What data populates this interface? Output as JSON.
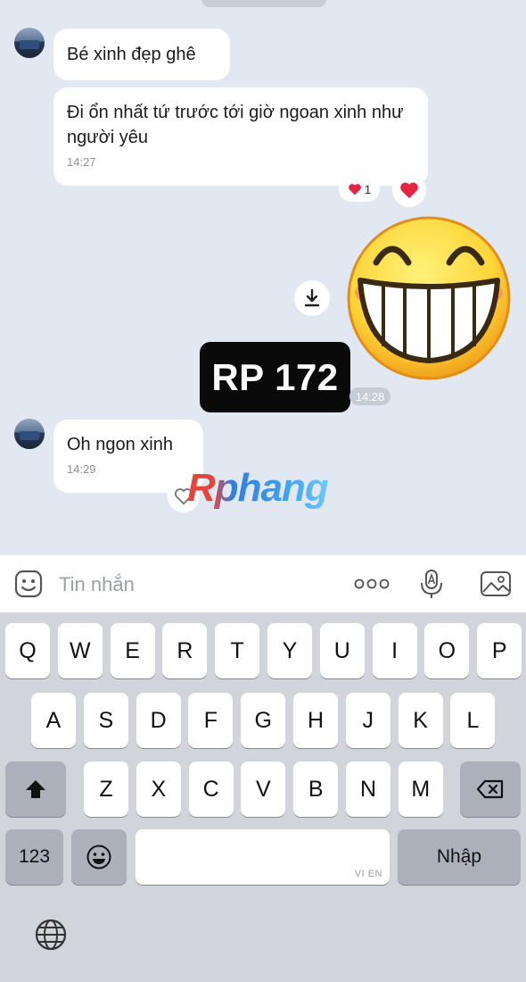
{
  "messages": [
    {
      "text": "Bé xinh đẹp ghê"
    },
    {
      "text": "Đi ổn nhất tứ trước tới giờ ngoan xinh như người yêu",
      "time": "14:27"
    },
    {
      "text": "Oh ngon xinh",
      "time": "14:29"
    }
  ],
  "reactions": {
    "heart_count": "1"
  },
  "sticker": {
    "label": "RP 172",
    "time": "14:28"
  },
  "watermark": "Rphang",
  "input": {
    "placeholder": "Tin nhắn"
  },
  "keyboard": {
    "row1": [
      "Q",
      "W",
      "E",
      "R",
      "T",
      "Y",
      "U",
      "I",
      "O",
      "P"
    ],
    "row2": [
      "A",
      "S",
      "D",
      "F",
      "G",
      "H",
      "J",
      "K",
      "L"
    ],
    "row3": [
      "Z",
      "X",
      "C",
      "V",
      "B",
      "N",
      "M"
    ],
    "numbers_label": "123",
    "return_label": "Nhập",
    "space_lang": "VI EN"
  },
  "colors": {
    "chat_bg": "#e2e8f1",
    "heart": "#e8233f",
    "keyboard_bg": "#d1d4da"
  }
}
